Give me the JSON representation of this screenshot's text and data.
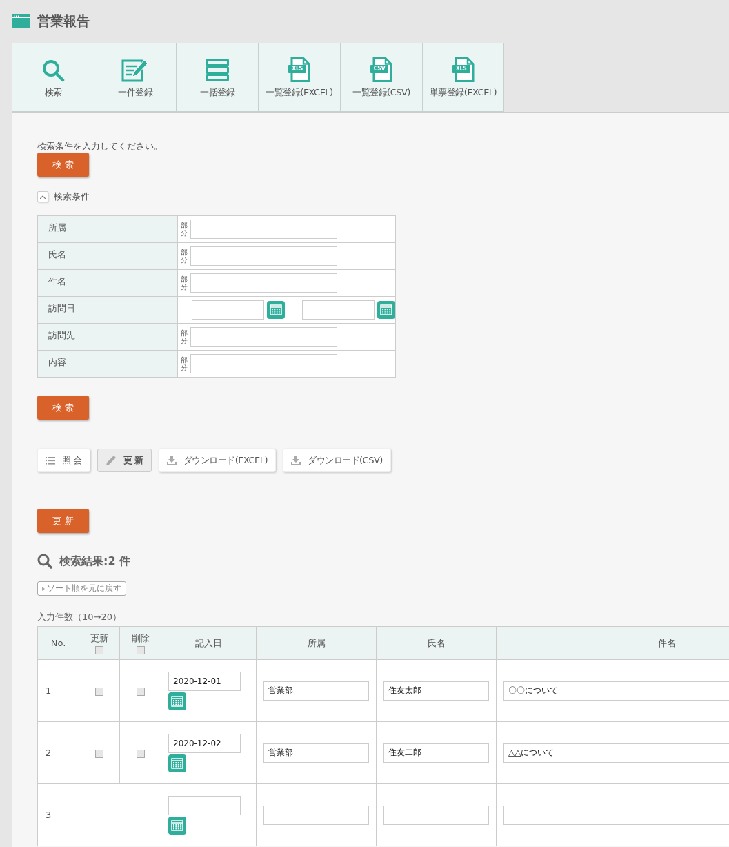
{
  "page_title": "営業報告",
  "tabs": [
    {
      "kind": "search",
      "label": "検索"
    },
    {
      "kind": "edit",
      "label": "一件登録"
    },
    {
      "kind": "bulk",
      "label": "一括登録"
    },
    {
      "kind": "file",
      "badge": "XLS",
      "label": "一覧登録(EXCEL)"
    },
    {
      "kind": "file",
      "badge": "CSV",
      "label": "一覧登録(CSV)"
    },
    {
      "kind": "file",
      "badge": "XLS",
      "label": "単票登録(EXCEL)"
    }
  ],
  "instruction": "検索条件を入力してください。",
  "search_button_top": "検 索",
  "conditions": {
    "title": "検索条件",
    "expanded": true,
    "rows": [
      {
        "kind": "text",
        "label": "所属",
        "match": "部分"
      },
      {
        "kind": "text",
        "label": "氏名",
        "match": "部分"
      },
      {
        "kind": "text",
        "label": "件名",
        "match": "部分"
      },
      {
        "kind": "date_range",
        "label": "訪問日",
        "separator": "-"
      },
      {
        "kind": "text",
        "label": "訪問先",
        "match": "部分"
      },
      {
        "kind": "text",
        "label": "内容",
        "match": "部分"
      }
    ]
  },
  "search_button_bottom": "検 索",
  "mode_buttons": [
    {
      "kind": "list",
      "label": "照 会",
      "selected": false
    },
    {
      "kind": "edit",
      "label": "更 新",
      "selected": true
    },
    {
      "kind": "download",
      "label": "ダウンロード(EXCEL)",
      "selected": false
    },
    {
      "kind": "download",
      "label": "ダウンロード(CSV)",
      "selected": false
    }
  ],
  "update_button": "更 新",
  "results_title": "検索結果:2 件",
  "reset_sort_button": "ソート順を元に戻す",
  "input_count_link": "入力件数（10→20）",
  "table": {
    "columns": [
      {
        "kind": "text",
        "label": "No."
      },
      {
        "kind": "check",
        "label": "更新",
        "checked": false
      },
      {
        "kind": "check",
        "label": "削除",
        "checked": false
      },
      {
        "kind": "text",
        "label": "記入日"
      },
      {
        "kind": "text",
        "label": "所属"
      },
      {
        "kind": "text",
        "label": "氏名"
      },
      {
        "kind": "text",
        "label": "件名"
      }
    ],
    "rows": [
      {
        "kind": "existing",
        "no": "1",
        "update": false,
        "delete": false,
        "date": "2020-12-01",
        "department": "営業部",
        "name": "住友太郎",
        "subject": "〇〇について"
      },
      {
        "kind": "existing",
        "no": "2",
        "update": false,
        "delete": false,
        "date": "2020-12-02",
        "department": "営業部",
        "name": "住友二郎",
        "subject": "△△について"
      },
      {
        "kind": "new",
        "no": "3"
      }
    ]
  }
}
